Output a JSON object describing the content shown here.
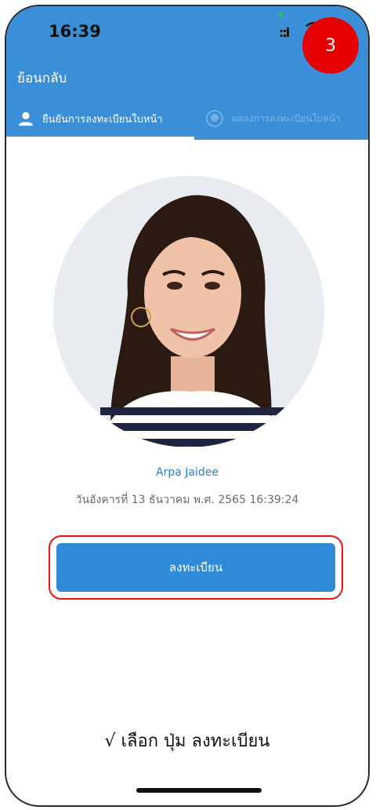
{
  "status_bar": {
    "time": "16:39",
    "signal_text": "::l"
  },
  "step_badge": "3",
  "header": {
    "back_label": "ย้อนกลับ"
  },
  "tabs": [
    {
      "label": "ยืนยันการลงทะเบียนใบหน้า",
      "icon": "person-icon",
      "active": true
    },
    {
      "label": "ผลลงการลงทะเบียนใบหน้า",
      "icon": "face-icon",
      "active": false
    }
  ],
  "profile": {
    "name": "Arpa Jaidee",
    "datetime": "วันอังคารที่ 13 ธันวาคม พ.ศ. 2565 16:39:24"
  },
  "register_button": {
    "label": "ลงทะเบียน"
  },
  "instruction": "√ เลือก ปุ่ม ลงทะเบียน",
  "colors": {
    "primary": "#3a8fd8",
    "button": "#2f8bd8",
    "name_text": "#2a7fc9",
    "badge": "#e60000",
    "highlight": "#e11111"
  }
}
